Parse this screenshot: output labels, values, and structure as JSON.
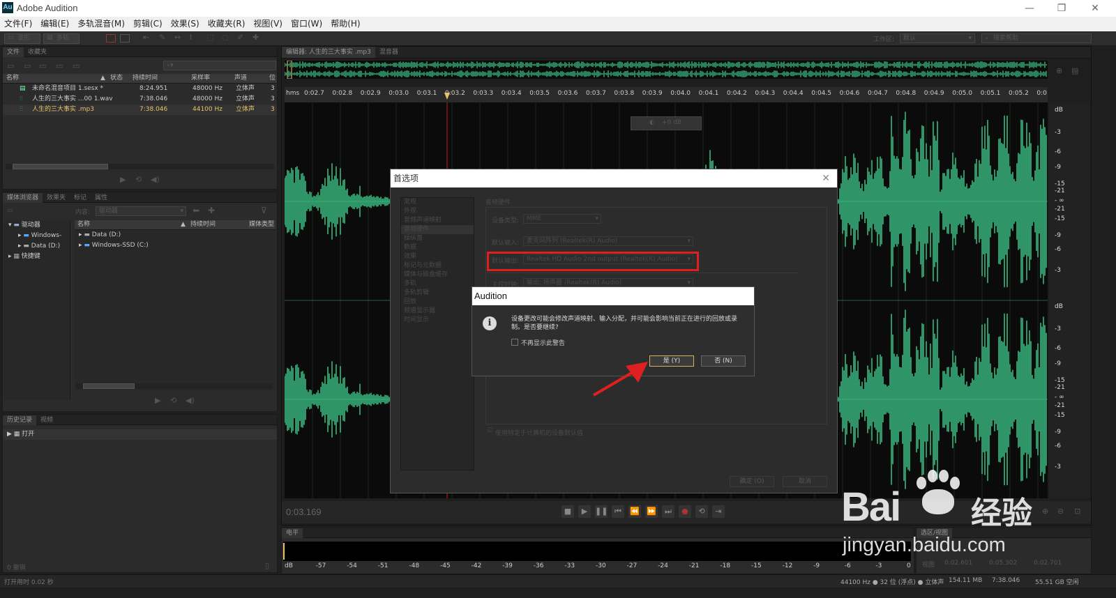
{
  "app": {
    "logo": "Au",
    "title": "Adobe Audition"
  },
  "window_buttons": {
    "minimize": "—",
    "restore": "❐",
    "close": "✕"
  },
  "menu": [
    "文件(F)",
    "编辑(E)",
    "多轨混音(M)",
    "剪辑(C)",
    "效果(S)",
    "收藏夹(R)",
    "视图(V)",
    "窗口(W)",
    "帮助(H)"
  ],
  "toolbar": {
    "waveform": "波形",
    "multitrack": "多轨",
    "workspace_label": "工作区:",
    "workspace_value": "默认",
    "search_placeholder": "搜索帮助"
  },
  "files_panel": {
    "tabs": [
      "文件",
      "收藏夹"
    ],
    "columns": [
      "名称",
      "状态",
      "持续时间",
      "采样率",
      "声道",
      "位"
    ],
    "rows": [
      {
        "name": "未命名混音项目 1.sesx *",
        "duration": "8:24.951",
        "rate": "48000 Hz",
        "channels": "立体声",
        "bits": "3"
      },
      {
        "name": "人生的三大事实 ...00 1.wav",
        "duration": "7:38.046",
        "rate": "48000 Hz",
        "channels": "立体声",
        "bits": "3"
      },
      {
        "name": "人生的三大事实 .mp3",
        "duration": "7:38.046",
        "rate": "44100 Hz",
        "channels": "立体声",
        "bits": "3"
      }
    ]
  },
  "media_panel": {
    "tabs": [
      "媒体浏览器",
      "效果夹",
      "标记",
      "属性"
    ],
    "content_label": "内容:",
    "content_value": "驱动器",
    "tree": [
      "驱动器",
      "Windows-",
      "Data (D:)",
      "快捷键"
    ],
    "columns": [
      "名称",
      "持续时间",
      "媒体类型"
    ],
    "rows": [
      "Data (D:)",
      "Windows-SSD (C:)"
    ]
  },
  "history_panel": {
    "tabs": [
      "历史记录",
      "视频"
    ],
    "items": [
      "打开"
    ],
    "footer": "0 撤销"
  },
  "editor": {
    "tab": "编辑器: 人生的三大事实 .mp3",
    "mixer_tab": "混音器",
    "timecode": "0:03.169",
    "ruler_unit": "hms",
    "ruler": [
      "0:02.7",
      "0:02.8",
      "0:02.9",
      "0:03.0",
      "0:03.1",
      "0:03.2",
      "0:03.3",
      "0:03.4",
      "0:03.5",
      "0:03.6",
      "0:03.7",
      "0:03.8",
      "0:03.9",
      "0:04.0",
      "0:04.1",
      "0:04.2",
      "0:04.3",
      "0:04.4",
      "0:04.5",
      "0:04.6",
      "0:04.7",
      "0:04.8",
      "0:04.9",
      "0:05.0",
      "0:05.1",
      "0:05.2",
      "0:0"
    ],
    "hud": "+0 dB",
    "db_scale_top": [
      "dB",
      "-3",
      "-6",
      "-9",
      "-15",
      "-21",
      "- ∞",
      "-21",
      "-15",
      "-9",
      "-6",
      "-3"
    ],
    "db_scale_bottom": [
      "dB",
      "-3",
      "-6",
      "-9",
      "-15",
      "-21",
      "- ∞",
      "-21",
      "-15",
      "-9",
      "-6",
      "-3"
    ]
  },
  "levels": {
    "tab": "电平",
    "scale": [
      "dB",
      "-57",
      "-54",
      "-51",
      "-48",
      "-45",
      "-42",
      "-39",
      "-36",
      "-33",
      "-30",
      "-27",
      "-24",
      "-21",
      "-18",
      "-15",
      "-12",
      "-9",
      "-6",
      "-3",
      "0"
    ]
  },
  "selection_panel": {
    "tab": "选区/视图",
    "labels": [
      "视图",
      "0:02.601",
      "0:05.302",
      "0:02.701"
    ]
  },
  "prefs_dialog": {
    "title": "首选项",
    "categories": [
      "常规",
      "外观",
      "音频声道映射",
      "音频硬件",
      "操纵面",
      "数据",
      "效果",
      "标记与元数据",
      "媒体与磁盘缓存",
      "多轨",
      "多轨剪辑",
      "回放",
      "频谱显示器",
      "时间显示"
    ],
    "section": "音频硬件",
    "device_type_label": "设备类型:",
    "device_type_value": "MME",
    "default_input_label": "默认输入:",
    "default_input_value": "麦克风阵列 (Realtek(R) Audio)",
    "default_output_label": "默认输出:",
    "default_output_value": "Realtek HD Audio 2nd output (Realtek(R) Audio)",
    "master_clock_label": "主控时钟:",
    "master_clock_value": "输出: 扬声器 (Realtek(R) Audio)",
    "use_default_label": "使用特定于计算机的设备默认值",
    "ok": "确定 (O)",
    "cancel": "取消"
  },
  "alert_dialog": {
    "title": "Audition",
    "message": "设备更改可能会修改声道映射、输入分配，并可能会影响当前正在进行的回放或录制。是否要继续?",
    "checkbox": "不再显示此警告",
    "yes": "是 (Y)",
    "no": "否 (N)"
  },
  "status": {
    "left": "打开用时 0.02 秒",
    "rate": "44100 Hz ● 32 位 (浮点) ● 立体声",
    "size": "154.11 MB",
    "duration": "7:38.046",
    "free": "55.51 GB 空闲"
  },
  "watermark": {
    "brand": "Bai",
    "brand2": "经验",
    "url": "jingyan.baidu.com"
  },
  "colors": {
    "wave": "#3fd08f",
    "highlight": "#e02020",
    "accent": "#e8c36a"
  }
}
